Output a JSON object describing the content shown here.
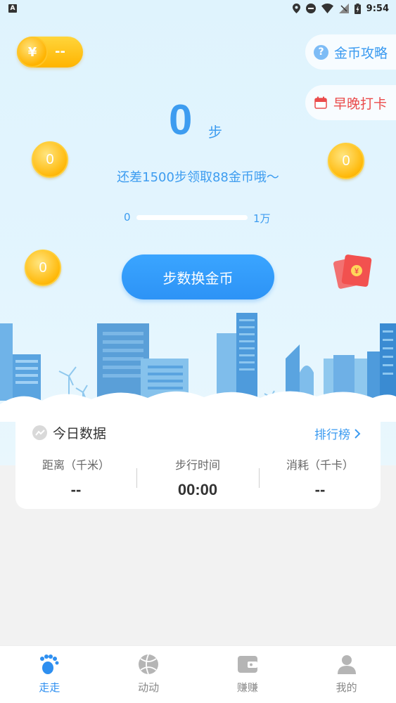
{
  "status_bar": {
    "time": "9:54",
    "left_badge": "A"
  },
  "balance": {
    "symbol": "¥",
    "value": "--"
  },
  "guide": {
    "label": "金币攻略",
    "icon": "?"
  },
  "checkin": {
    "label": "早晚打卡"
  },
  "steps": {
    "value": "0",
    "unit": "步"
  },
  "hint": "还差1500步领取88金币哦～",
  "progress": {
    "min": "0",
    "max": "1万",
    "fraction": 0
  },
  "coins": [
    "0",
    "0",
    "0"
  ],
  "exchange_button": "步数换金币",
  "redpacket_symbol": "¥",
  "today_card": {
    "title": "今日数据",
    "ranking_link": "排行榜",
    "stats": [
      {
        "label": "距离（千米）",
        "value": "--"
      },
      {
        "label": "步行时间",
        "value": "00:00"
      },
      {
        "label": "消耗（千卡）",
        "value": "--"
      }
    ]
  },
  "nav": [
    {
      "label": "走走",
      "icon": "footprint-icon",
      "active": true
    },
    {
      "label": "动动",
      "icon": "ball-icon",
      "active": false
    },
    {
      "label": "赚赚",
      "icon": "wallet-icon",
      "active": false
    },
    {
      "label": "我的",
      "icon": "person-icon",
      "active": false
    }
  ],
  "colors": {
    "accent": "#3d9cf0",
    "coin": "#ffb90a",
    "checkin_red": "#ea4b4b"
  }
}
